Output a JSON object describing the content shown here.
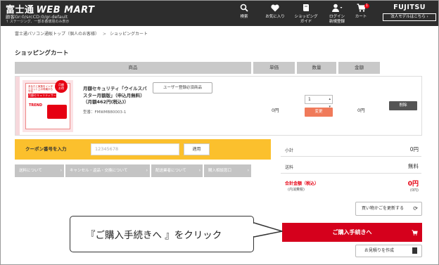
{
  "header": {
    "logo_main": "富士通",
    "logo_web": "WEB MART",
    "sub1": "顧客Gr:0/srcCD:0/gr-default",
    "sub2": "↑ ステージング、一部本番環境のみ表示",
    "nav": [
      {
        "icon": "search-icon",
        "label": "検索"
      },
      {
        "icon": "heart-icon",
        "label": "お気に入り"
      },
      {
        "icon": "book-icon",
        "label": "ショッピング\nガイド"
      },
      {
        "icon": "user-icon",
        "label": "ログイン\n新規登録"
      },
      {
        "icon": "cart-icon",
        "label": "カート",
        "badge": "1"
      }
    ],
    "brand": "FUJITSU",
    "brand_button": "法人モデルはこちら ›"
  },
  "breadcrumb": {
    "items": [
      "富士通パソコン通販トップ（個人のお客様）",
      "ショッピングカート"
    ],
    "separator": ">"
  },
  "page_title": "ショッピングカート",
  "table": {
    "headers": {
      "product": "商品",
      "unit_price": "単価",
      "quantity": "数量",
      "amount": "金額"
    }
  },
  "item": {
    "thumbnail": {
      "badge": "月額\nお得",
      "top_text": "あなたと家族をインターネット上の脅威から守る",
      "service_label": "月額セキュリティサービス",
      "brand": "TREND"
    },
    "name": "月額セキュリティ「ウイルスバスター月額版」（申込月無料）（月額462円(税込)）",
    "model": "型番：FMWMB80003-1",
    "user_button": "ユーザー登録必須商品",
    "unit_price": "0円",
    "quantity": "1",
    "change_button": "変更",
    "amount": "0円",
    "delete_button": "削除"
  },
  "coupon": {
    "label": "クーポン番号を入力",
    "placeholder": "12345678",
    "apply_button": "適用"
  },
  "info_links": [
    "送料について",
    "キャンセル・返品・交換について",
    "配送業者について",
    "購入相談窓口"
  ],
  "summary": {
    "subtotal_label": "小計",
    "subtotal_value": "0円",
    "shipping_label": "送料",
    "shipping_value": "無料",
    "total_label": "合計金額（税込）",
    "total_sub": "(内消費税)",
    "total_value": "0円",
    "tax_value": "(0円)"
  },
  "buttons": {
    "update_cart": "買い物かごを更新する",
    "proceed": "ご購入手続きへ",
    "estimate": "お見積りを作成"
  },
  "callout": {
    "text": "『ご購入手続きへ 』をクリック"
  },
  "colors": {
    "header_bg": "#2d2d2d",
    "accent_red": "#d5001c",
    "coupon_bg": "#fbc02d",
    "change_btn": "#f07a5a"
  }
}
